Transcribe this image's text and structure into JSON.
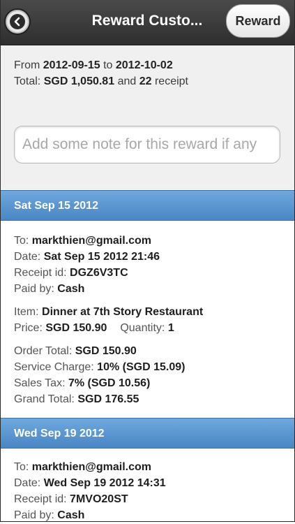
{
  "header": {
    "title": "Reward Custo...",
    "reward_label": "Reward",
    "back_icon": "back-chevron-icon"
  },
  "summary": {
    "from_label": "From",
    "from_date": "2012-09-15",
    "to_label": "to",
    "to_date": "2012-10-02",
    "total_label": "Total:",
    "total_amount": "SGD 1,050.81",
    "and_label": "and",
    "receipt_count": "22",
    "receipt_label": "receipt"
  },
  "note": {
    "value": "",
    "placeholder": "Add some note for this reward if any"
  },
  "days": [
    {
      "heading": "Sat Sep 15 2012",
      "receipt": {
        "to_label": "To:",
        "to": "markthien@gmail.com",
        "date_label": "Date:",
        "date": "Sat Sep 15 2012 21:46",
        "receipt_id_label": "Receipt id:",
        "receipt_id": "DGZ6V3TC",
        "paid_by_label": "Paid by:",
        "paid_by": "Cash",
        "item_label": "Item:",
        "item": "Dinner at 7th Story Restaurant",
        "price_label": "Price:",
        "price": "SGD 150.90",
        "quantity_label": "Quantity:",
        "quantity": "1",
        "order_total_label": "Order Total:",
        "order_total": "SGD 150.90",
        "service_charge_label": "Service Charge:",
        "service_charge": "10% (SGD 15.09)",
        "sales_tax_label": "Sales Tax:",
        "sales_tax": "7% (SGD 10.56)",
        "grand_total_label": "Grand Total:",
        "grand_total": "SGD 176.55"
      }
    },
    {
      "heading": "Wed Sep 19 2012",
      "receipt": {
        "to_label": "To:",
        "to": "markthien@gmail.com",
        "date_label": "Date:",
        "date": "Wed Sep 19 2012 14:31",
        "receipt_id_label": "Receipt id:",
        "receipt_id": "7MVO20ST",
        "paid_by_label": "Paid by:",
        "paid_by": "Cash"
      }
    }
  ],
  "colors": {
    "header_bg": "#3a3a3a",
    "day_header_bg": "#5a95d2",
    "summary_bg": "#f0f0f0"
  }
}
